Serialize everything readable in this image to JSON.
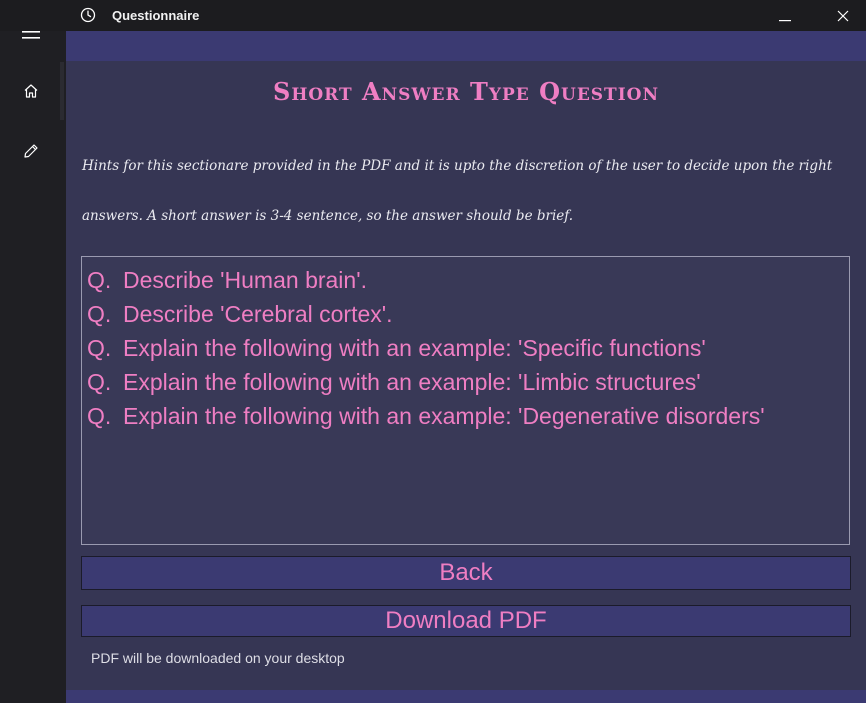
{
  "window": {
    "title": "Questionnaire",
    "minimize_symbol": "—",
    "close_symbol": "✕"
  },
  "sidebar": {
    "items": [
      {
        "name": "hamburger-menu",
        "icon": "hamburger-icon"
      },
      {
        "name": "home",
        "icon": "home-icon"
      },
      {
        "name": "edit",
        "icon": "pencil-icon"
      }
    ]
  },
  "page": {
    "title": "Short Answer Type Question",
    "hint_line_1": "Hints for this sectionare provided in the PDF and it is upto the discretion of the user to decide upon the right",
    "hint_line_2": "answers. A short answer is 3-4 sentence, so the answer should be brief."
  },
  "questions": [
    {
      "prefix": "Q.",
      "text": "Describe 'Human brain'."
    },
    {
      "prefix": "Q.",
      "text": "Describe 'Cerebral cortex'."
    },
    {
      "prefix": "Q.",
      "text": "Explain the following with an example: 'Specific functions'"
    },
    {
      "prefix": "Q.",
      "text": "Explain the following with an example: 'Limbic structures'"
    },
    {
      "prefix": "Q.",
      "text": "Explain the following with an example: 'Degenerative disorders'"
    }
  ],
  "buttons": {
    "back_label": "Back",
    "download_label": "Download PDF"
  },
  "footer": {
    "note": "PDF will be downloaded on your desktop"
  },
  "colors": {
    "accent_pink": "#ef7ec3",
    "band_purple": "#3b3a72",
    "content_bg": "#363654",
    "sidebar_bg": "#1f1f23"
  }
}
